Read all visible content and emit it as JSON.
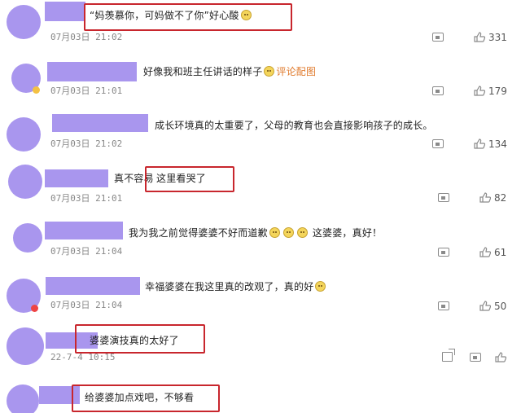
{
  "comments": [
    {
      "text": "“妈羡慕你，可妈做不了你”好心酸",
      "emoji_after": 1,
      "time": "07月03日 21:02",
      "likes": "331",
      "link": ""
    },
    {
      "text": "好像我和班主任讲话的样子",
      "emoji_after": 1,
      "time": "07月03日 21:01",
      "likes": "179",
      "link": "评论配图"
    },
    {
      "text": "成长环境真的太重要了，父母的教育也会直接影响孩子的成长。",
      "emoji_after": 0,
      "time": "07月03日 21:02",
      "likes": "134",
      "link": ""
    },
    {
      "text_a": "真不容易",
      "text_b": "这里看哭了",
      "time": "07月03日 21:01",
      "likes": "82"
    },
    {
      "text_a": "我为我之前觉得婆婆不好而道歉",
      "text_b": "这婆婆，真好！",
      "time": "07月03日 21:04",
      "likes": "61"
    },
    {
      "text": "幸福婆婆在我这里真的改观了，真的好",
      "emoji_after": 1,
      "time": "07月03日 21:04",
      "likes": "50"
    },
    {
      "text": "婆婆演技真的太好了",
      "time": "22-7-4 10:15",
      "likes": ""
    },
    {
      "text": "给婆婆加点戏吧，不够看",
      "time": "",
      "likes": ""
    }
  ],
  "icons": {
    "comment": "comment-icon",
    "like": "thumbs-up-icon",
    "share": "share-icon",
    "emoji": "crying-emoji-icon"
  },
  "colors": {
    "placeholder": "#a996ee",
    "highlight_box": "#c8262d",
    "link": "#e07a2c"
  }
}
